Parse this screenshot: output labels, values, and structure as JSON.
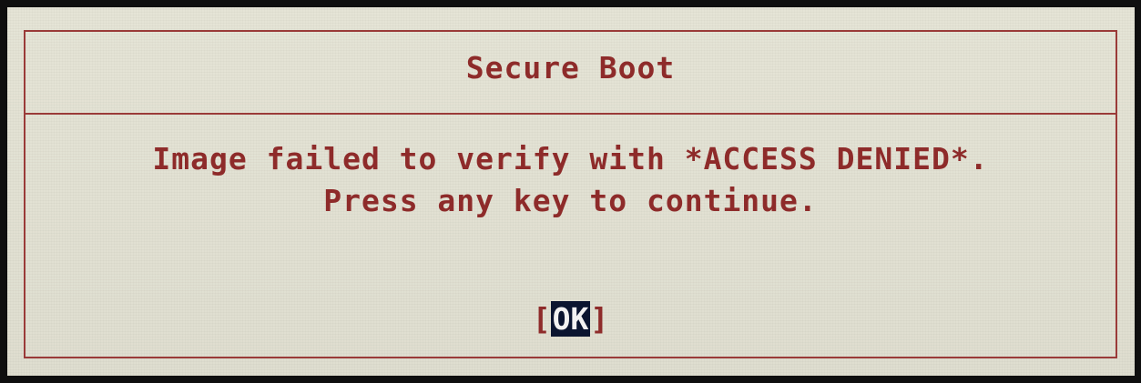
{
  "dialog": {
    "title": "Secure Boot",
    "message_line1": "Image failed to verify with *ACCESS DENIED*.",
    "message_line2": "Press any key to continue.",
    "ok_bracket_left": "[",
    "ok_label": "OK",
    "ok_bracket_right": "]"
  },
  "colors": {
    "text": "#8e2b2a",
    "border": "#9a3a38",
    "background": "#e2e1d3",
    "selected_button_bg": "#0b1530",
    "selected_button_fg": "#f2f2f2"
  }
}
